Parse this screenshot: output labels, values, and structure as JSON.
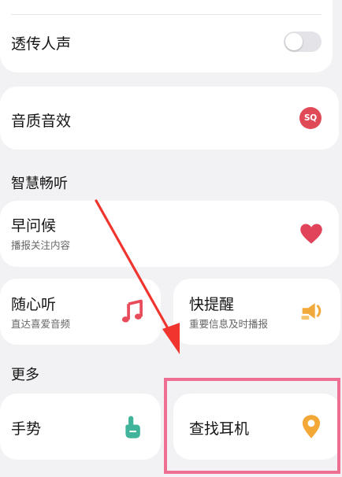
{
  "items": {
    "transparency": {
      "label": "透传人声",
      "toggle_on": false
    },
    "sound_quality": {
      "label": "音质音效",
      "badge": "SQ"
    },
    "greeting": {
      "label": "早问候",
      "sub": "播报关注内容"
    },
    "listen": {
      "label": "随心听",
      "sub": "直达喜爱音频"
    },
    "reminder": {
      "label": "快提醒",
      "sub": "重要信息及时播报"
    },
    "gesture": {
      "label": "手势"
    },
    "find": {
      "label": "查找耳机"
    }
  },
  "sections": {
    "smart": "智慧畅听",
    "more": "更多"
  },
  "colors": {
    "heart": "#e0435a",
    "note": "#e84b5a",
    "speaker": "#f2a93b",
    "hand": "#3fb49a",
    "pin": "#f3a736",
    "arrow": "#f0352f",
    "highlight": "#ef6f93"
  },
  "icons": [
    "sq-badge-icon",
    "heart-icon",
    "music-note-icon",
    "speaker-icon",
    "hand-gesture-icon",
    "location-pin-icon"
  ]
}
